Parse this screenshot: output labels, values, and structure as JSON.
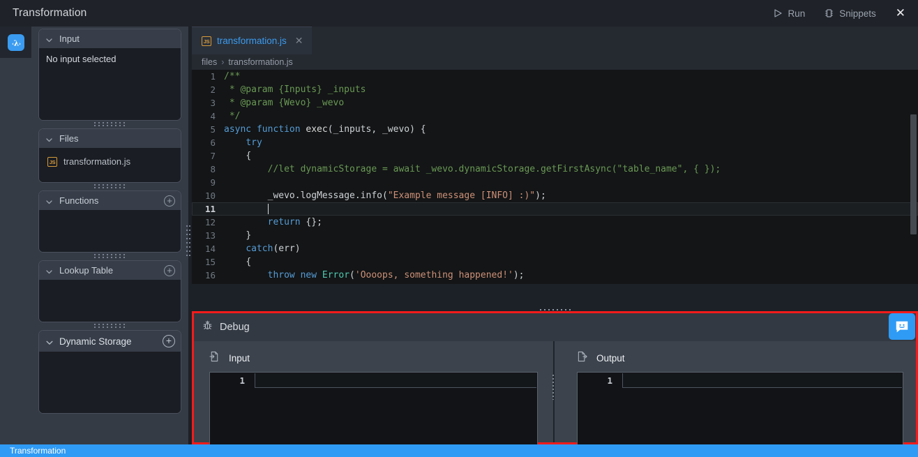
{
  "window": {
    "title": "Transformation",
    "lambda_icon": "lambda-icon"
  },
  "titlebar_actions": {
    "run_label": "Run",
    "run_icon": "play-icon",
    "snippets_label": "Snippets",
    "snippets_icon": "chip-icon",
    "close_icon": "close-icon",
    "close_glyph": "✕"
  },
  "sidebar": {
    "panels": [
      {
        "title": "Input",
        "chevron": "chevron-down-icon",
        "empty_text": "No input selected",
        "has_add": false
      },
      {
        "title": "Files",
        "chevron": "chevron-down-icon",
        "has_add": false,
        "files": [
          {
            "name": "transformation.js",
            "badge": "JS"
          }
        ]
      },
      {
        "title": "Functions",
        "chevron": "chevron-down-icon",
        "has_add": true,
        "add_glyph": "+"
      },
      {
        "title": "Lookup Table",
        "chevron": "chevron-down-icon",
        "has_add": true,
        "add_glyph": "+"
      },
      {
        "title": "Dynamic Storage",
        "chevron": "chevron-down-icon",
        "has_add": true,
        "add_glyph": "+"
      }
    ]
  },
  "editor": {
    "tab": {
      "label": "transformation.js",
      "badge": "JS",
      "close_glyph": "✕"
    },
    "breadcrumb": {
      "root": "files",
      "separator": "›",
      "leaf": "transformation.js"
    },
    "active_line": 11,
    "lines": [
      {
        "n": 1,
        "text": "/**"
      },
      {
        "n": 2,
        "text": " * @param {Inputs} _inputs"
      },
      {
        "n": 3,
        "text": " * @param {Wevo} _wevo"
      },
      {
        "n": 4,
        "text": " */"
      },
      {
        "n": 5,
        "text": "async function exec(_inputs, _wevo) {"
      },
      {
        "n": 6,
        "text": "    try"
      },
      {
        "n": 7,
        "text": "    {"
      },
      {
        "n": 8,
        "text": "        //let dynamicStorage = await _wevo.dynamicStorage.getFirstAsync(\"table_name\", { });"
      },
      {
        "n": 9,
        "text": ""
      },
      {
        "n": 10,
        "text": "        _wevo.logMessage.info(\"Example message [INFO] :)\");"
      },
      {
        "n": 11,
        "text": ""
      },
      {
        "n": 12,
        "text": "        return {};"
      },
      {
        "n": 13,
        "text": "    }"
      },
      {
        "n": 14,
        "text": "    catch(err)"
      },
      {
        "n": 15,
        "text": "    {"
      },
      {
        "n": 16,
        "text": "        throw new Error('Oooops, something happened!');"
      }
    ]
  },
  "debug": {
    "title": "Debug",
    "icon": "bug-icon",
    "input": {
      "label": "Input",
      "icon": "import-icon",
      "line_numbers": [
        "1"
      ],
      "value": ""
    },
    "output": {
      "label": "Output",
      "icon": "export-icon",
      "line_numbers": [
        "1"
      ],
      "value": ""
    }
  },
  "chat": {
    "icon": "chat-smiley-icon"
  },
  "taskbar": {
    "item_label": "Transformation"
  },
  "colors": {
    "accent_blue": "#2f9bf5",
    "tab_active_text": "#3a9bf0",
    "debug_highlight": "#f51b1b",
    "js_badge": "#d89b3a",
    "editor_bg": "#131516",
    "sidebar_bg": "#353b45"
  }
}
